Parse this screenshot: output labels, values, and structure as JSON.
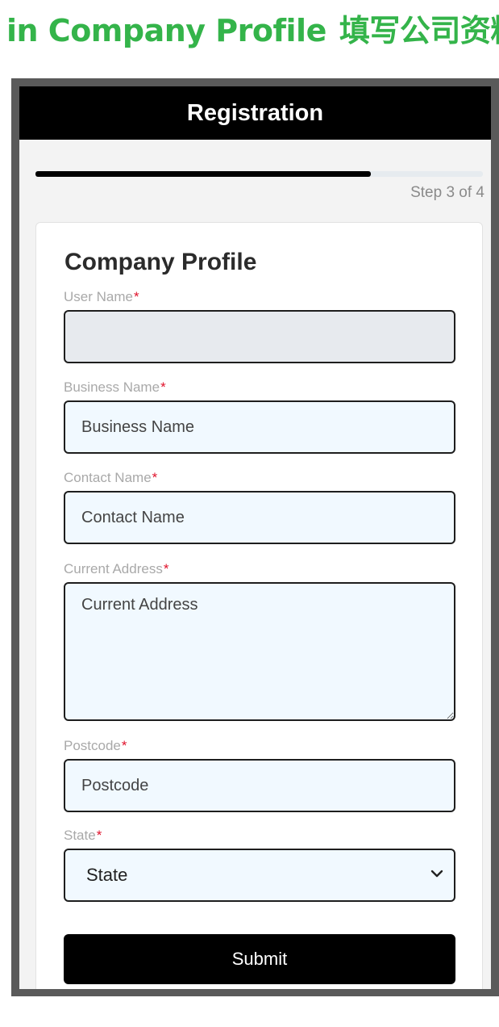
{
  "banner": {
    "prefix": "in Company Profile",
    "chinese": "填写公司资料"
  },
  "header": {
    "title": "Registration"
  },
  "progress": {
    "fraction": 0.75,
    "label": "Step 3 of 4"
  },
  "form": {
    "title": "Company Profile",
    "required_mark": "*",
    "user_name": {
      "label": "User Name",
      "value": ""
    },
    "business_name": {
      "label": "Business Name",
      "placeholder": "Business Name"
    },
    "contact_name": {
      "label": "Contact Name",
      "placeholder": "Contact Name"
    },
    "current_address": {
      "label": "Current Address",
      "placeholder": "Current Address"
    },
    "postcode": {
      "label": "Postcode",
      "placeholder": "Postcode"
    },
    "state": {
      "label": "State",
      "selected": "State"
    },
    "submit_label": "Submit"
  },
  "icons": {
    "dropdown": "chevron-down-icon",
    "resize": "resize-grip-icon"
  },
  "colors": {
    "brand_green": "#34b44a",
    "required": "#e0122b",
    "input_bg": "#f1f9ff"
  }
}
